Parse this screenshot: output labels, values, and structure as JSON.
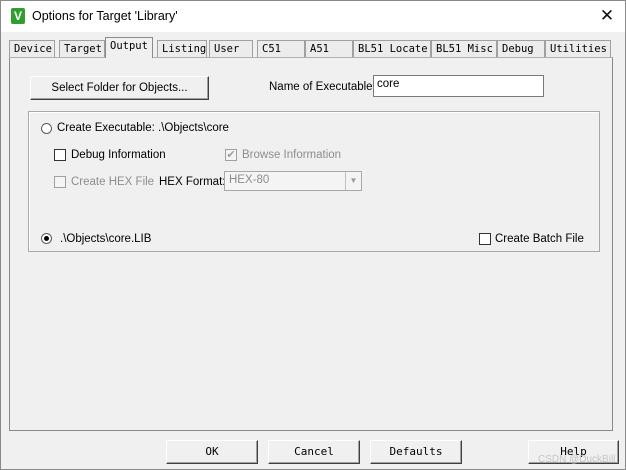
{
  "window": {
    "title": "Options for Target 'Library'",
    "app_icon": "V",
    "close_glyph": "✕"
  },
  "tabs": [
    {
      "label": "Device"
    },
    {
      "label": "Target"
    },
    {
      "label": "Output",
      "active": true
    },
    {
      "label": "Listing"
    },
    {
      "label": "User"
    },
    {
      "label": "C51"
    },
    {
      "label": "A51"
    },
    {
      "label": "BL51 Locate"
    },
    {
      "label": "BL51 Misc"
    },
    {
      "label": "Debug"
    },
    {
      "label": "Utilities"
    }
  ],
  "output": {
    "select_folder_label": "Select Folder for Objects...",
    "name_of_executable_label": "Name of Executable:",
    "name_of_executable_value": "core",
    "create_executable_label": "Create Executable:  .\\Objects\\core",
    "create_executable_selected": false,
    "debug_information_label": "Debug Information",
    "debug_information_checked": false,
    "browse_information_label": "Browse Information",
    "browse_information_checked": true,
    "create_hex_label": "Create HEX File",
    "create_hex_checked": false,
    "hex_format_label": "HEX Format:",
    "hex_format_value": "HEX-80",
    "create_library_label": ".\\Objects\\core.LIB",
    "create_library_selected": true,
    "create_batch_label": "Create Batch File",
    "create_batch_checked": false
  },
  "footer": {
    "ok": "OK",
    "cancel": "Cancel",
    "defaults": "Defaults",
    "help": "Help"
  },
  "watermark": "CSDN @DuckBill",
  "icons": {
    "app": "uvision-icon",
    "close": "close-icon",
    "dropdown": "chevron-down-icon"
  }
}
